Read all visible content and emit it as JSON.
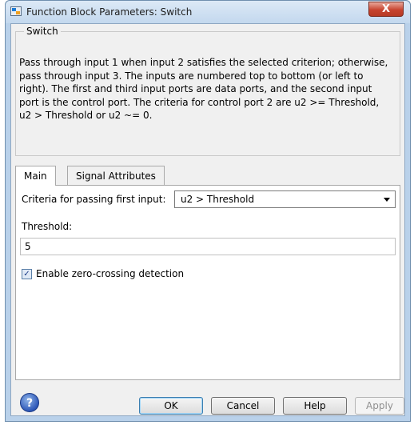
{
  "window": {
    "title": "Function Block Parameters: Switch",
    "close_label": "X"
  },
  "group": {
    "title": "Switch",
    "description": "Pass through input 1 when input 2 satisfies the selected criterion; otherwise, pass through input 3. The inputs are numbered top to bottom (or left to right). The first and third input ports are data ports, and the second input port is the control port. The criteria for control port 2 are u2 >= Threshold, u2 > Threshold or u2 ~= 0."
  },
  "tabs": {
    "main": "Main",
    "signal_attributes": "Signal Attributes"
  },
  "main": {
    "criteria_label": "Criteria for passing first input:",
    "criteria_value": "u2 > Threshold",
    "threshold_label": "Threshold:",
    "threshold_value": "5",
    "zero_crossing_label": "Enable zero-crossing detection",
    "zero_crossing_checked": true
  },
  "footer": {
    "help_icon": "?",
    "ok": "OK",
    "cancel": "Cancel",
    "help": "Help",
    "apply": "Apply"
  },
  "colors": {
    "frame": "#b9d1ea",
    "close": "#c7442f"
  }
}
